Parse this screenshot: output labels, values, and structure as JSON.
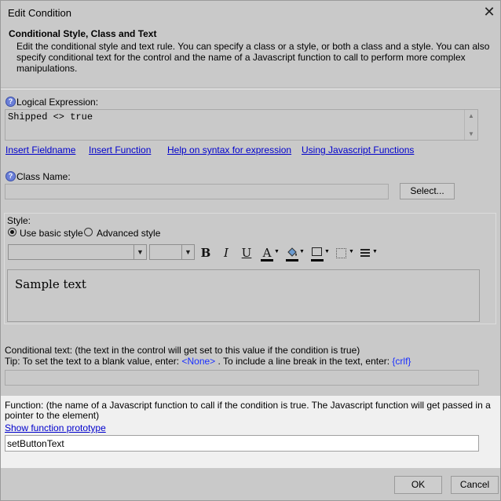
{
  "window": {
    "title": "Edit Condition",
    "close_glyph": "✕"
  },
  "header": {
    "title": "Conditional Style, Class and Text",
    "description": "Edit the conditional style and text rule. You can specify a class or a style, or both a class and a style. You can also specify conditional text for the control and the name of a Javascript function to call to perform more complex manipulations."
  },
  "logical": {
    "label": "Logical Expression:",
    "value": "Shipped <> true",
    "links": [
      "Insert Fieldname",
      "Insert Function",
      "Help on syntax for expression",
      "Using Javascript Functions"
    ]
  },
  "class_name": {
    "label": "Class Name:",
    "value": "",
    "select_label": "Select..."
  },
  "style": {
    "label": "Style:",
    "basic_label": "Use basic style",
    "advanced_label": "Advanced style",
    "selected": "basic",
    "font_name": "",
    "font_size": "",
    "bold": "B",
    "italic": "I",
    "underline": "U",
    "text_color_glyph": "A",
    "sample": "Sample text"
  },
  "conditional_text": {
    "line1": "Conditional text: (the text in the control will get set to this value if the condition is true)",
    "tip_a": "Tip: To set the text to a blank value, enter: ",
    "tip_none": "<None>",
    "tip_b": " . To include a line break in the text, enter: ",
    "tip_crlf": "{crlf}",
    "value": ""
  },
  "function": {
    "description": "Function: (the name of a Javascript function to call if the condition is true. The Javascript function will get passed in a pointer to the element)",
    "link": "Show function prototype",
    "value": "setButtonText"
  },
  "footer": {
    "ok": "OK",
    "cancel": "Cancel"
  },
  "colors": {
    "background": "#c9c9c9",
    "link": "#0000cc",
    "token": "#1a2fff",
    "function_area": "#f0f0f0"
  }
}
